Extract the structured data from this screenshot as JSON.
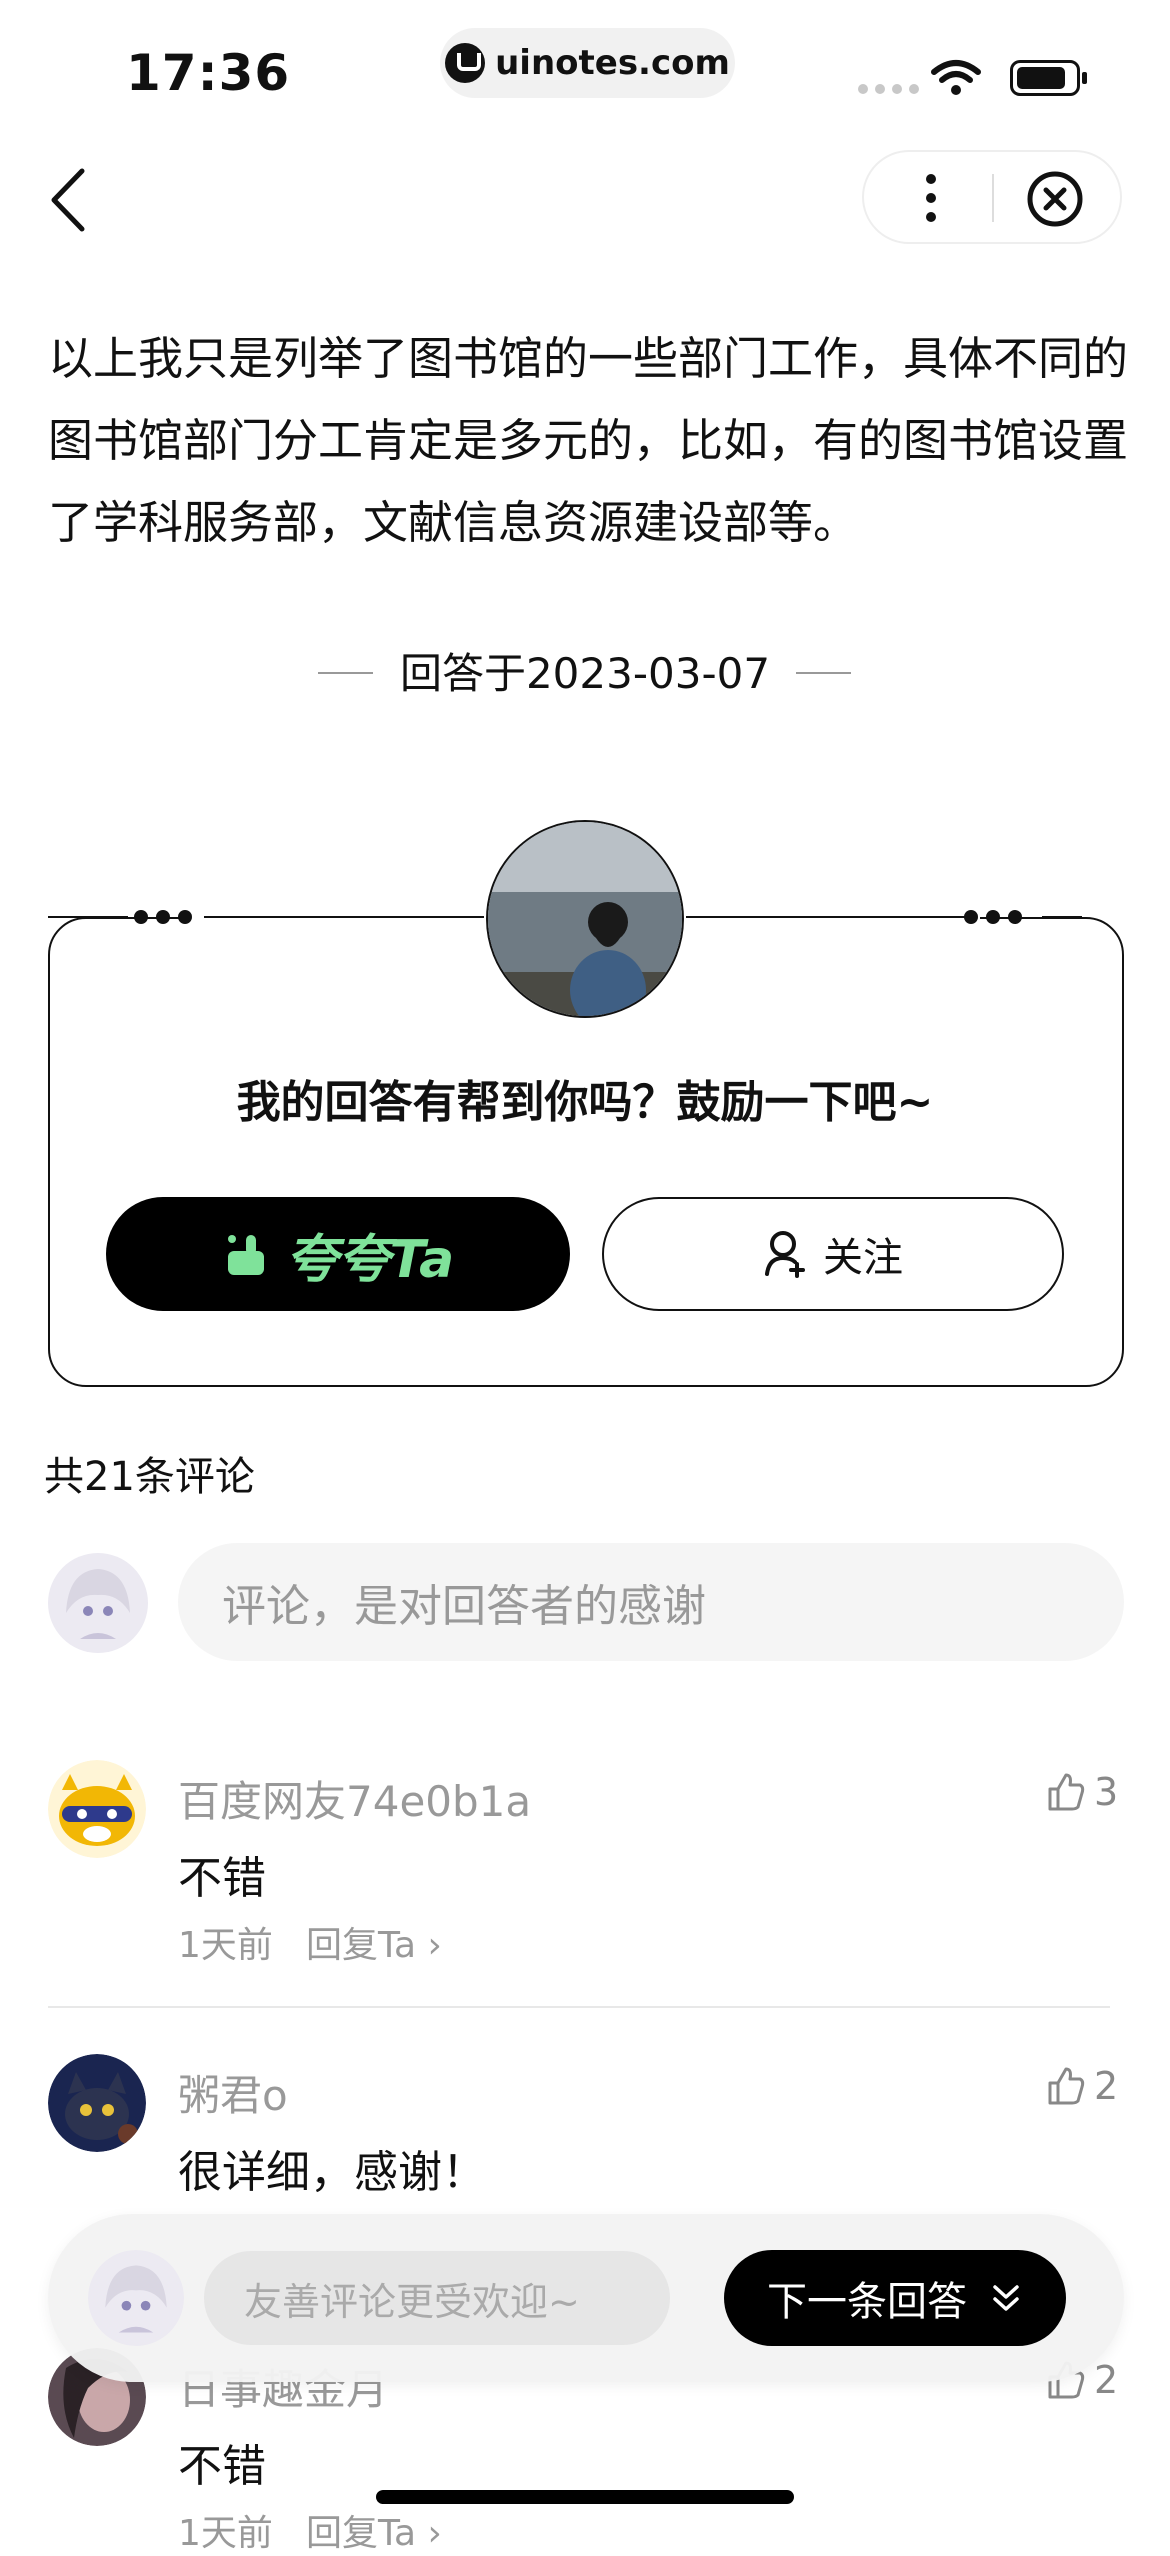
{
  "status_bar": {
    "time": "17:36",
    "url": "uinotes.com"
  },
  "article": {
    "body": "以上我只是列举了图书馆的一些部门工作，具体不同的图书馆部门分工肯定是多元的，比如，有的图书馆设置了学科服务部，文献信息资源建设部等。",
    "answered_on": "回答于2023-03-07"
  },
  "encourage_card": {
    "question": "我的回答有帮到你吗？鼓励一下吧~",
    "praise_label": "夸夸Ta",
    "follow_label": "关注"
  },
  "comments_section": {
    "count_label": "共21条评论",
    "input_placeholder": "评论，是对回答者的感谢",
    "comments": [
      {
        "author": "百度网友74e0b1a",
        "text": "不错",
        "time": "1天前",
        "reply_label": "回复Ta",
        "likes": "3"
      },
      {
        "author": "粥君o",
        "text": "很详细，感谢！",
        "likes": "2"
      },
      {
        "author": "日事趣金月",
        "text": "不错",
        "time": "1天前",
        "reply_label": "回复Ta",
        "likes": "2"
      }
    ]
  },
  "bottom_bar": {
    "input_placeholder": "友善评论更受欢迎~",
    "next_label": "下一条回答"
  },
  "colors": {
    "praise_text": "#7fe29a",
    "placeholder": "#999999"
  }
}
